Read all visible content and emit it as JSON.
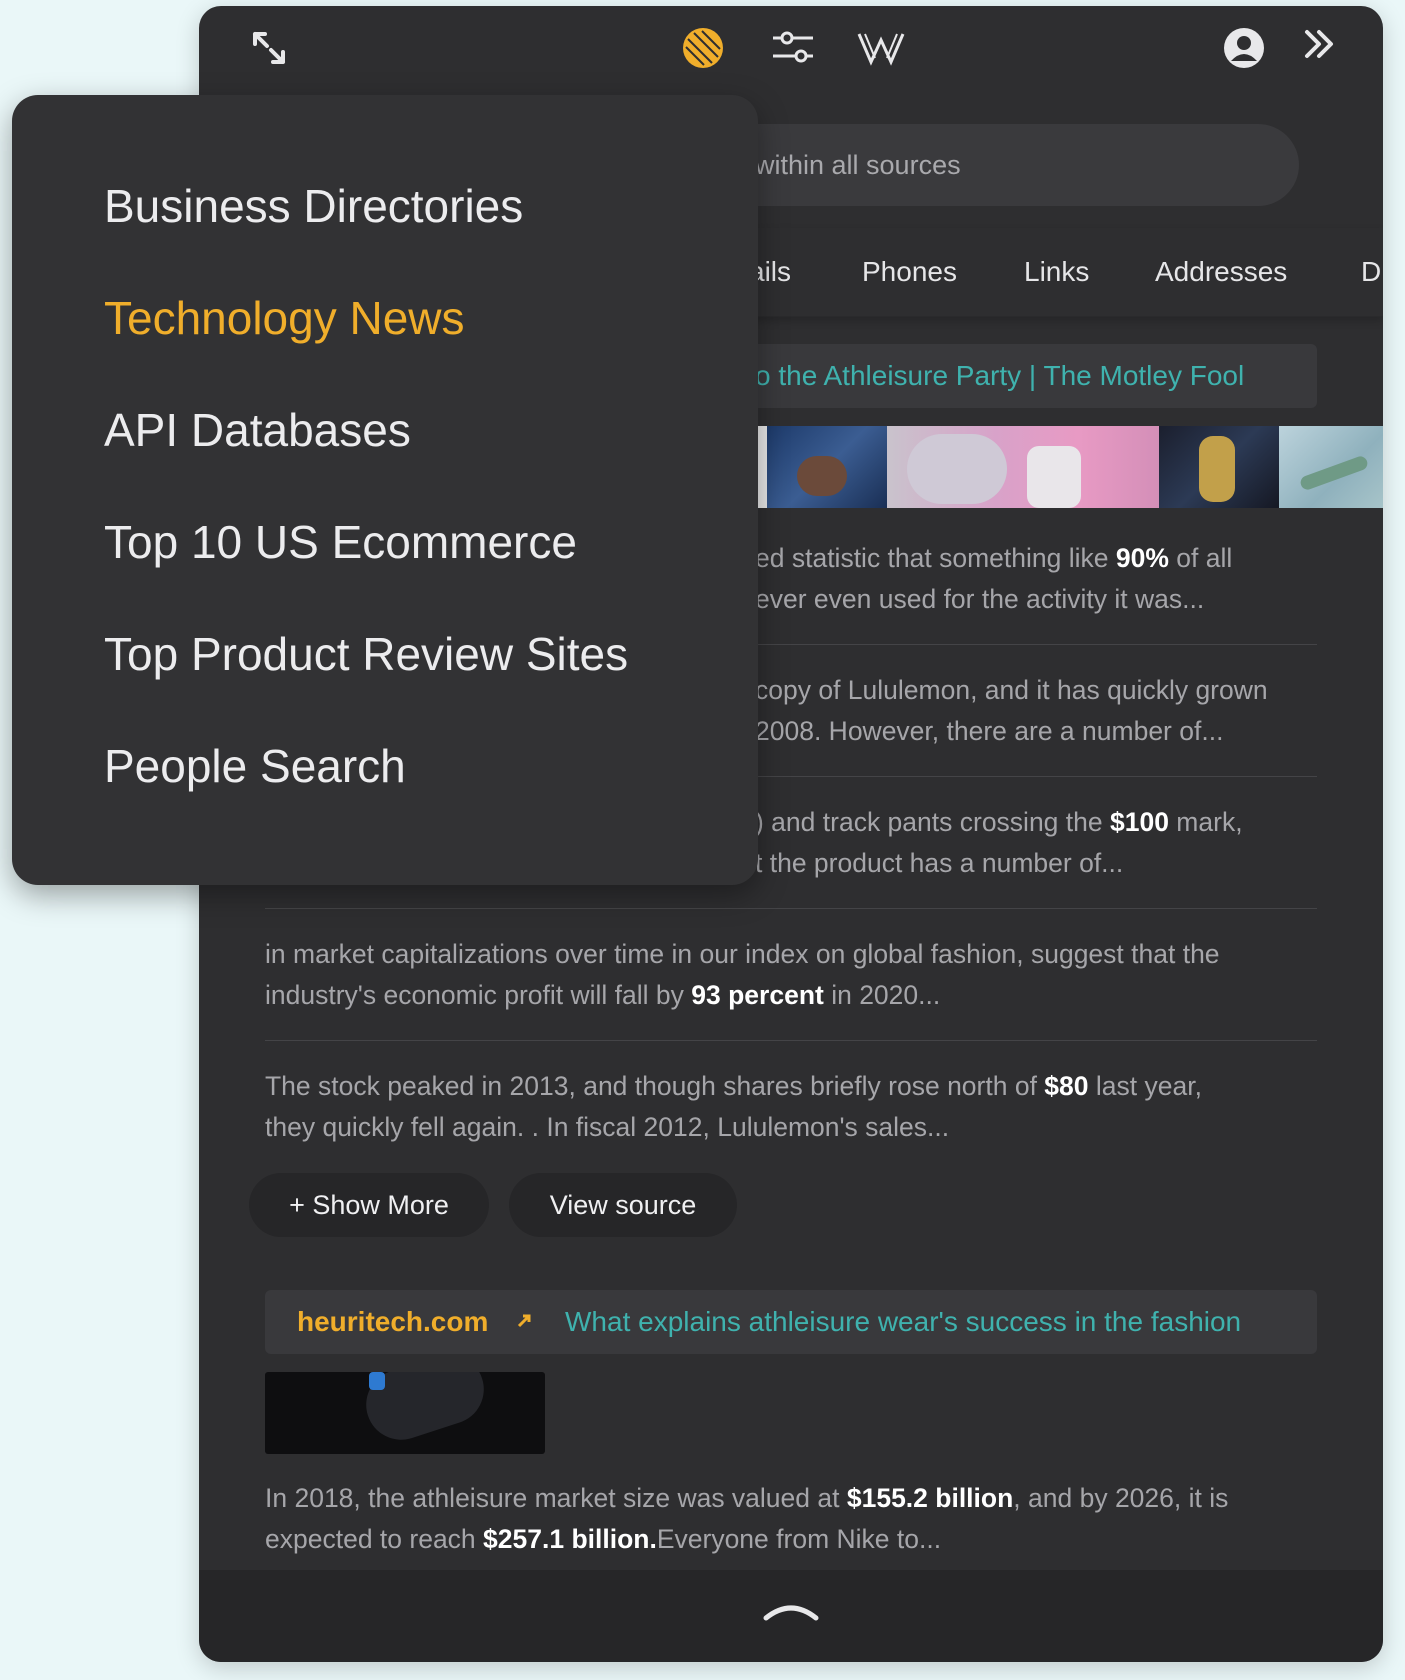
{
  "colors": {
    "background": "#eaf7f8",
    "panel": "#2e2e30",
    "accent": "#f0ae2b",
    "link": "#3fb2ae",
    "muted_text": "#a6a6aa"
  },
  "toolbar": {
    "icons": [
      "expand-icon",
      "logo-icon",
      "filter-sliders-icon",
      "w-icon",
      "user-avatar-icon",
      "double-chevron-right-icon"
    ]
  },
  "search": {
    "placeholder": "within all sources"
  },
  "tabs": [
    "ails",
    "Phones",
    "Links",
    "Addresses",
    "D"
  ],
  "dropdown": {
    "items": [
      {
        "label": "Business Directories",
        "active": false
      },
      {
        "label": "Technology News",
        "active": true
      },
      {
        "label": "API Databases",
        "active": false
      },
      {
        "label": "Top 10 US Ecommerce",
        "active": false
      },
      {
        "label": "Top Product Review Sites",
        "active": false
      },
      {
        "label": "People Search",
        "active": false
      }
    ]
  },
  "result1": {
    "title": "o the Athleisure Party | The Motley Fool",
    "snippets": [
      {
        "line1_pre": "ed statistic that something like ",
        "line1_bold": "90%",
        "line1_post": " of all",
        "line2": "ever even used for the activity it was..."
      },
      {
        "line1": "copy of Lululemon, and it has quickly grown",
        "line2": "2008. However, there are a number of..."
      },
      {
        "line1_pre": ") and track pants crossing the ",
        "line1_bold": "$100",
        "line1_post": " mark,",
        "line2": "t the product has a number of..."
      },
      {
        "line1": "in market capitalizations over time in our index on global fashion, suggest that the",
        "line2_pre": "industry's economic profit will fall by ",
        "line2_bold": "93 percent",
        "line2_post": " in 2020..."
      },
      {
        "line1_pre": "The stock peaked in 2013, and though shares briefly rose north of ",
        "line1_bold": "$80",
        "line1_post": " last year,",
        "line2": "they quickly fell again. . In fiscal 2012, Lululemon's sales..."
      }
    ],
    "show_more": "+ Show More",
    "view_source": "View source"
  },
  "result2": {
    "domain": "heuritech.com",
    "title": "What explains athleisure wear's success in the fashion",
    "snippet": {
      "l1_a": "In 2018, the athleisure market size was valued at ",
      "l1_b": "$155.2 billion",
      "l1_c": ", and by 2026, it is",
      "l2_a": "expected to reach ",
      "l2_b": "$257.1 billion.",
      "l2_c": "Everyone from Nike to..."
    }
  }
}
